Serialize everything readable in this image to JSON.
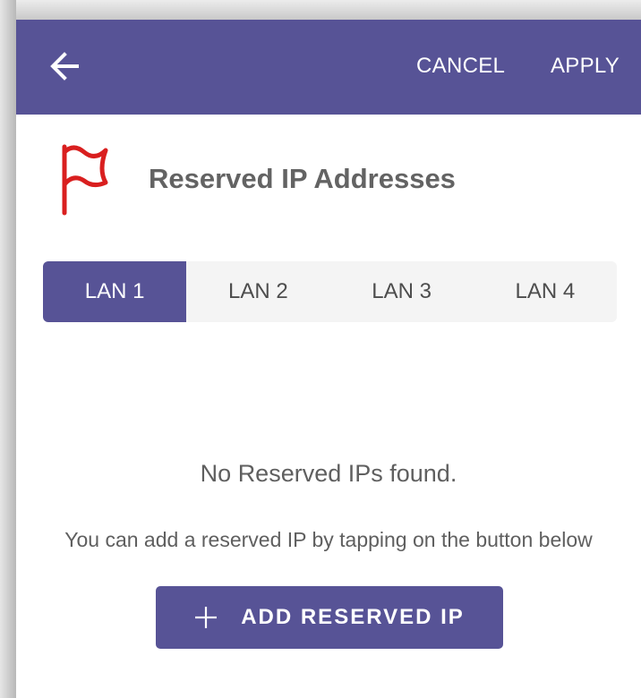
{
  "appbar": {
    "back_icon": "arrow-left-icon",
    "cancel_label": "CANCEL",
    "apply_label": "APPLY",
    "background": "#575396"
  },
  "header": {
    "icon": "flag-icon",
    "icon_color": "#d91f1f",
    "title": "Reserved IP Addresses"
  },
  "tabs": [
    {
      "label": "LAN 1",
      "selected": true
    },
    {
      "label": "LAN 2",
      "selected": false
    },
    {
      "label": "LAN 3",
      "selected": false
    },
    {
      "label": "LAN 4",
      "selected": false
    }
  ],
  "empty_state": {
    "title": "No Reserved IPs found.",
    "subtitle": "You can add a reserved IP by tapping on the button below"
  },
  "add_button": {
    "icon": "plus-icon",
    "label": "ADD RESERVED IP"
  },
  "colors": {
    "accent": "#575396",
    "tab_background": "#f4f4f4"
  }
}
